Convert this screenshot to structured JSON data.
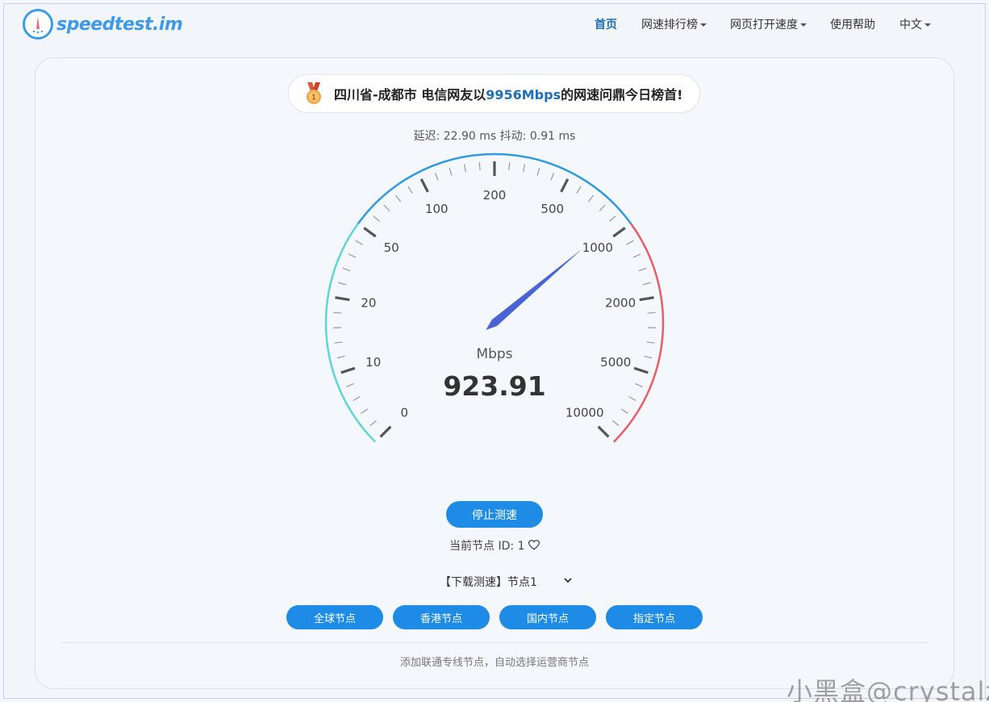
{
  "brand": {
    "logo_text": "speedtest.im"
  },
  "nav": {
    "items": [
      {
        "label": "首页",
        "active": true,
        "dropdown": false
      },
      {
        "label": "网速排行榜",
        "active": false,
        "dropdown": true
      },
      {
        "label": "网页打开速度",
        "active": false,
        "dropdown": true
      },
      {
        "label": "使用帮助",
        "active": false,
        "dropdown": false
      },
      {
        "label": "中文",
        "active": false,
        "dropdown": true
      }
    ]
  },
  "banner": {
    "icon": "medal-icon",
    "prefix": "四川省-成都市 电信网友以",
    "highlight": "9956Mbps",
    "suffix": "的网速问鼎今日榜首!"
  },
  "latency": {
    "text": "延迟: 22.90 ms 抖动: 0.91 ms"
  },
  "gauge": {
    "unit": "Mbps",
    "value_text": "923.91",
    "value": 923.91,
    "tick_labels": [
      "0",
      "10",
      "20",
      "50",
      "100",
      "200",
      "500",
      "1000",
      "2000",
      "5000",
      "10000"
    ],
    "colors": {
      "low": "#5dd6d8",
      "mid": "#2f9be0",
      "high": "#e85d68",
      "needle": "#4a64d8"
    }
  },
  "controls": {
    "stop_label": "停止测速",
    "node_id_text": "当前节点 ID: 1",
    "select_value": "【下载测速】节点1",
    "node_buttons": [
      "全球节点",
      "香港节点",
      "国内节点",
      "指定节点"
    ],
    "footer_note": "添加联通专线节点，自动选择运营商节点"
  },
  "watermark": "小黑盒@crystalz",
  "colors": {
    "accent": "#1e8ce6",
    "brand": "#3d9ae8",
    "active_nav": "#1d6fb8"
  }
}
